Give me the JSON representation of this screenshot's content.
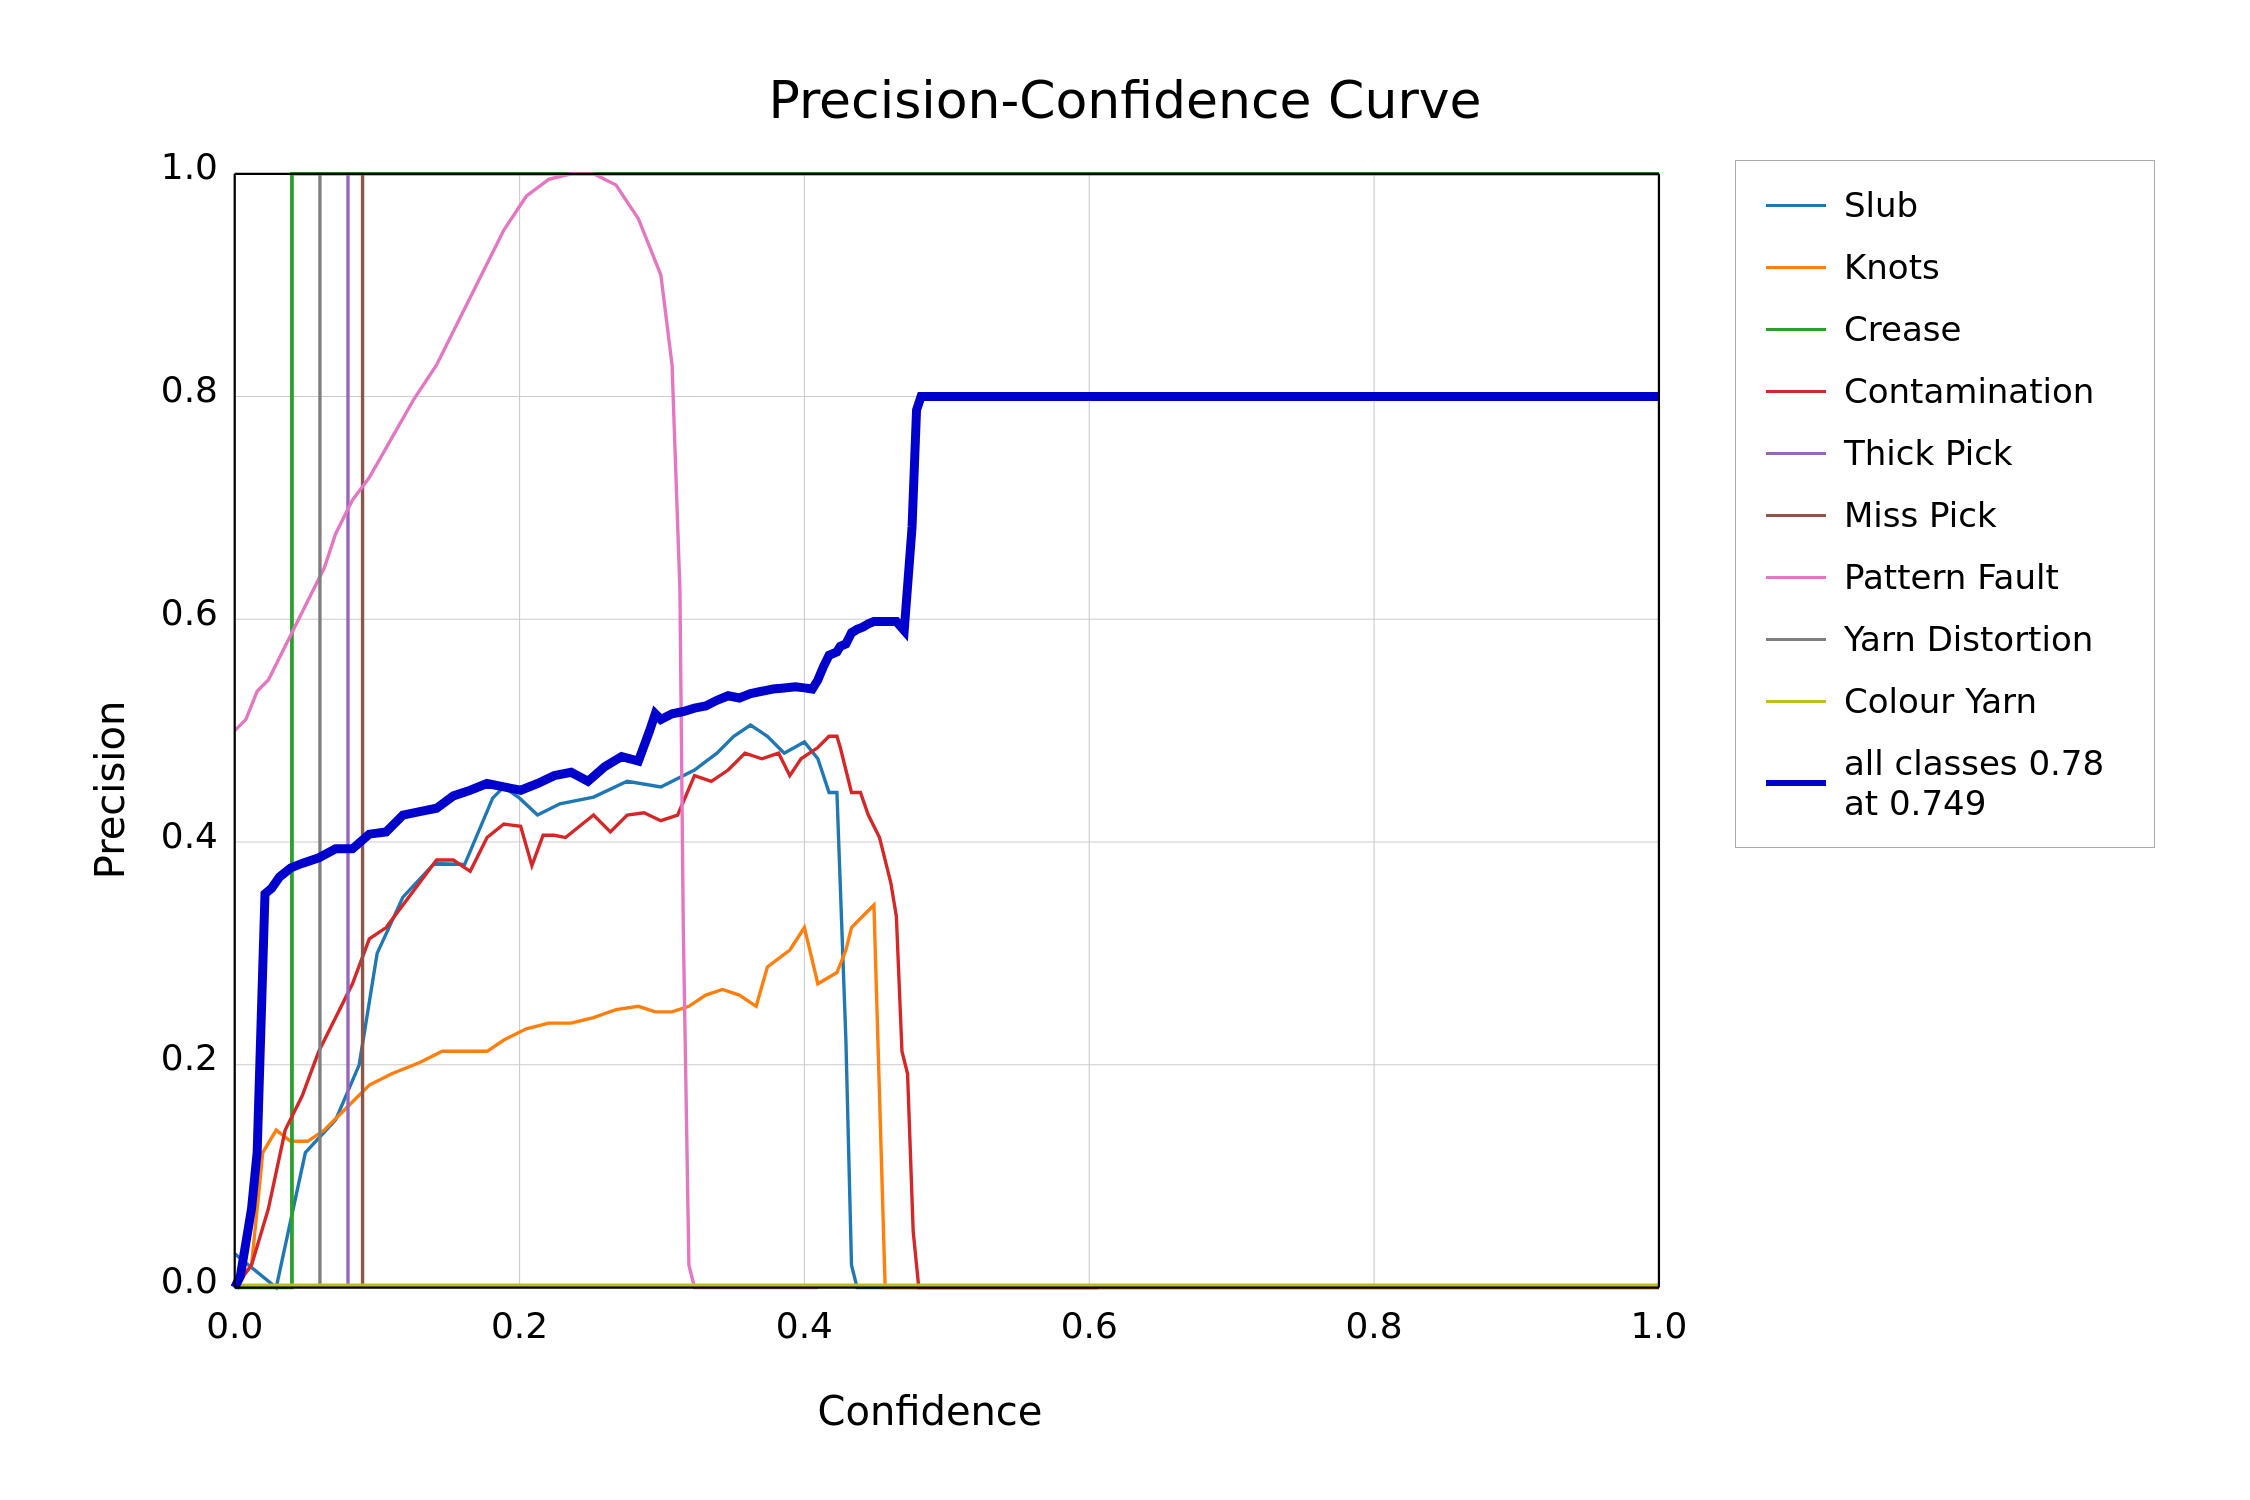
{
  "title": "Precision-Confidence Curve",
  "x_label": "Confidence",
  "y_label": "Precision",
  "x_ticks": [
    "0.0",
    "0.2",
    "0.4",
    "0.6",
    "0.8",
    "1.0"
  ],
  "y_ticks": [
    "0.0",
    "0.2",
    "0.4",
    "0.6",
    "0.8",
    "1.0"
  ],
  "legend": [
    {
      "label": "Slub",
      "color": "#1f77b4",
      "thick": false
    },
    {
      "label": "Knots",
      "color": "#ff7f0e",
      "thick": false
    },
    {
      "label": "Crease",
      "color": "#2ca02c",
      "thick": false
    },
    {
      "label": "Contamination",
      "color": "#d62728",
      "thick": false
    },
    {
      "label": "Thick Pick",
      "color": "#9467bd",
      "thick": false
    },
    {
      "label": "Miss Pick",
      "color": "#8c564b",
      "thick": false
    },
    {
      "label": "Pattern Fault",
      "color": "#e377c2",
      "thick": false
    },
    {
      "label": "Yarn Distortion",
      "color": "#7f7f7f",
      "thick": false
    },
    {
      "label": "Colour Yarn",
      "color": "#bcbd22",
      "thick": false
    },
    {
      "label": "all classes 0.78 at 0.749",
      "color": "#0000cd",
      "thick": true
    }
  ]
}
